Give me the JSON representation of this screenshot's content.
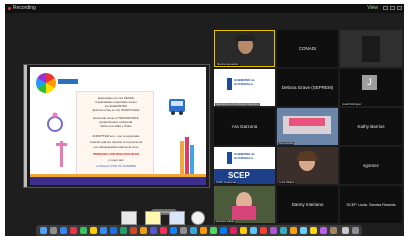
{
  "window": {
    "recording_label": "Recording",
    "view_label": "View"
  },
  "slide": {
    "lines": [
      {
        "text": "Especiales son los PECES",
        "style": "plain"
      },
      {
        "text": "Capacidades especiales tienen",
        "style": "plain"
      },
      {
        "text": "los ELEFANTES",
        "style": "plain"
      },
      {
        "text": "Enfermos hay en los HOSPITALES",
        "style": "plain"
      },
      {
        "text": "",
        "style": "plain"
      },
      {
        "text": "Encerado viene el TRANSPORTE",
        "style": "plain"
      },
      {
        "text": "contaminación ambiental.",
        "style": "plain"
      },
      {
        "text": "Retra una Valla y Útiles",
        "style": "plain"
      },
      {
        "text": "",
        "style": "plain"
      },
      {
        "text": "ANDOTTER son - son a especiales",
        "style": "plain"
      },
      {
        "text": "Cuando quieres referirte a una persona",
        "style": "plain"
      },
      {
        "text": "con discapacidad solamente di es",
        "style": "plain"
      },
      {
        "text": "PERSONA CON DISCAPACIDAD",
        "style": "red"
      },
      {
        "text": "y mejor aún",
        "style": "plain"
      },
      {
        "text": "LLÁMALO POR SU NOMBRE",
        "style": "blue"
      }
    ]
  },
  "participants": [
    {
      "id": "speaker",
      "name": "",
      "label": "Monica Hernandez"
    },
    {
      "id": "conadi",
      "name": "CONADI",
      "label": ""
    },
    {
      "id": "camera-right",
      "name": "",
      "label": ""
    },
    {
      "id": "secretaria",
      "name": "",
      "label": "Secretaría de Coordinación Ejecutiva"
    },
    {
      "id": "debora",
      "name": "Debora Grave (SEPREM)",
      "label": ""
    },
    {
      "id": "j",
      "name": "J",
      "label": "Josefi Rodríguez"
    },
    {
      "id": "ara",
      "name": "Ara Garzona",
      "label": ""
    },
    {
      "id": "bridge",
      "name": "",
      "label": "Ana Huertas"
    },
    {
      "id": "kathy",
      "name": "Kathy Barrios",
      "label": ""
    },
    {
      "id": "scep-guatemala",
      "name": "",
      "label": "SCEP Guatemala"
    },
    {
      "id": "lucia",
      "name": "",
      "label": "Lucia Raquel"
    },
    {
      "id": "sagomez",
      "name": "sgomez",
      "label": ""
    },
    {
      "id": "veronica",
      "name": "",
      "label": "Veronica Cañas"
    },
    {
      "id": "danny",
      "name": "Danny Interiano",
      "label": ""
    },
    {
      "id": "scep-sandra",
      "name": "SCEP Licda. Sandra Reanda",
      "label": ""
    }
  ],
  "logos": {
    "gobierno_line1": "GOBIERNO de",
    "gobierno_line2": "GUATEMALA",
    "scep_text": "SCEP"
  },
  "controls": {
    "minimize_label": "Minimized"
  },
  "colors": {
    "dock": "#3a3a3a",
    "slide_band": "#3d2f8f",
    "slide_accent": "#f2a73b"
  }
}
